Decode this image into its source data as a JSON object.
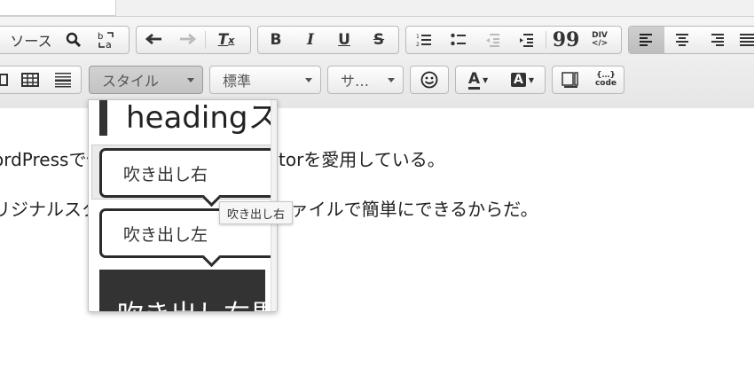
{
  "toolbar": {
    "source_label": "ソース",
    "style_combo": "スタイル",
    "format_combo": "標準",
    "size_combo": "サ…",
    "codeq_label": "code"
  },
  "content": {
    "line1": "ordPressで使うエディタは、CKEditorを愛用している。",
    "line2": "リジナルスタイルの追加などが、jsファイルで簡単にできるからだ。"
  },
  "style_dropdown": {
    "items": [
      {
        "label": "headingスタイル"
      },
      {
        "label": "吹き出し右"
      },
      {
        "label": "吹き出し左"
      },
      {
        "label": "吹き出し右黒"
      }
    ]
  },
  "tooltip": "吹き出し右"
}
